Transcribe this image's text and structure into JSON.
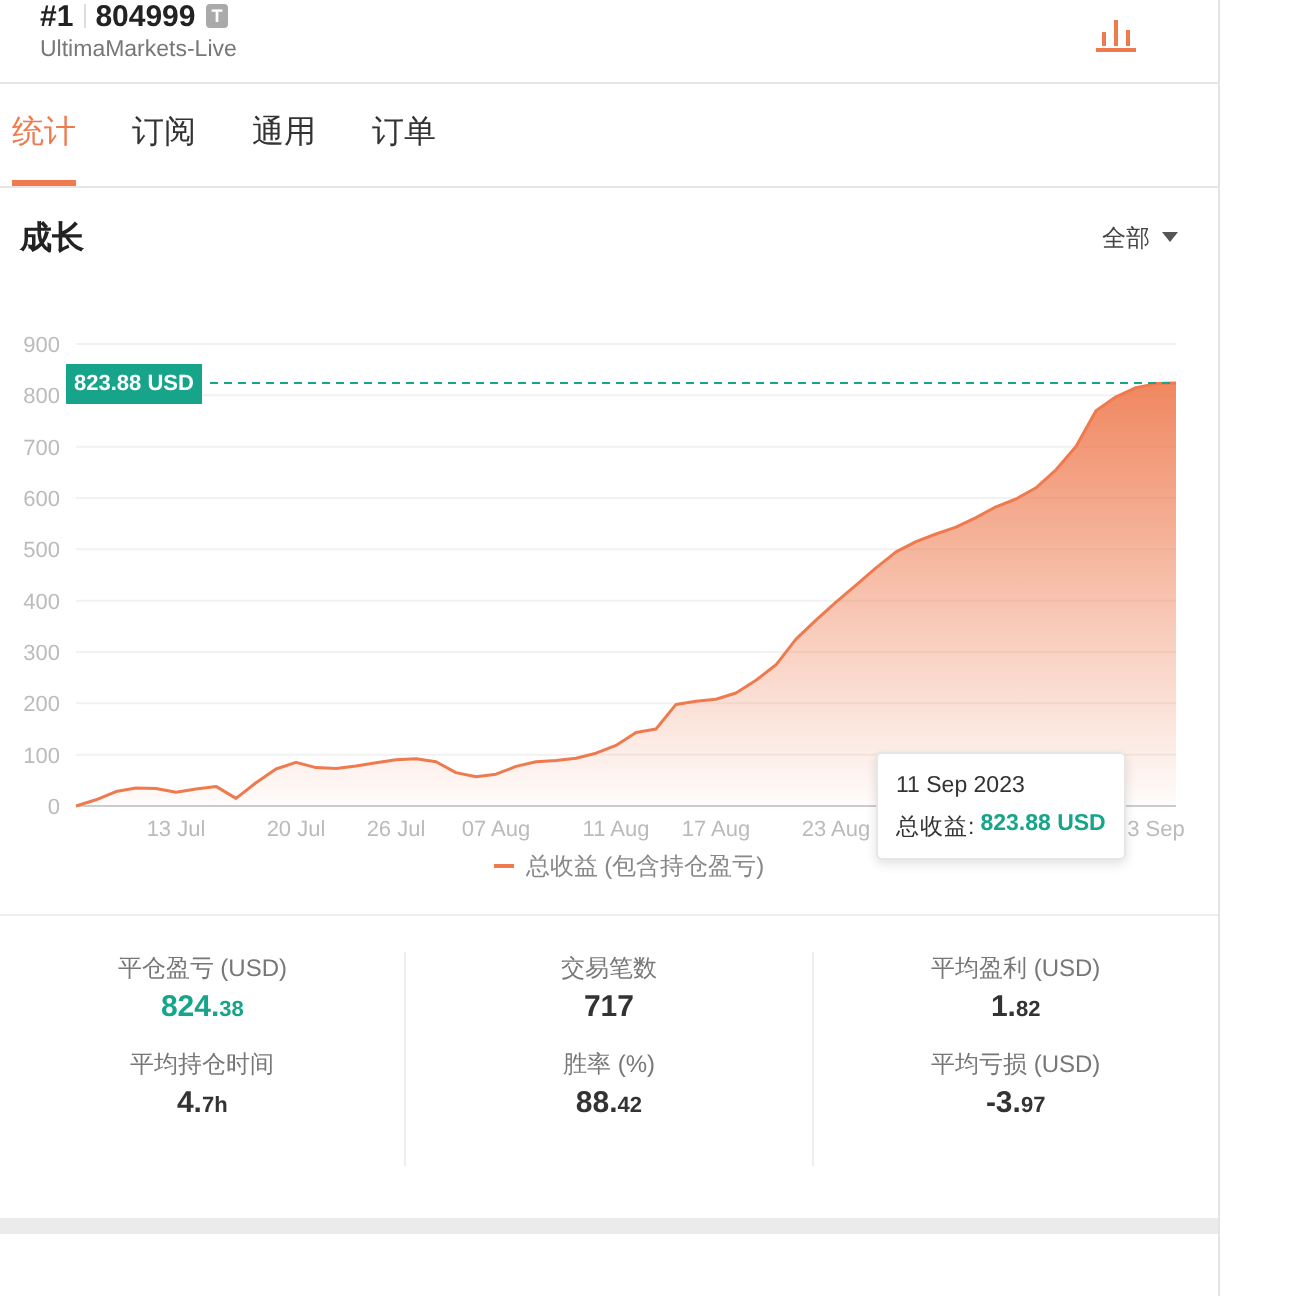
{
  "header": {
    "rank": "#1",
    "account": "804999",
    "badge": "T",
    "server": "UltimaMarkets-Live"
  },
  "tabs": [
    {
      "label": "统计",
      "selected": true
    },
    {
      "label": "订阅",
      "selected": false
    },
    {
      "label": "通用",
      "selected": false
    },
    {
      "label": "订单",
      "selected": false
    }
  ],
  "section": {
    "title": "成长",
    "filter": "全部"
  },
  "chart": {
    "price_label": "823.88 USD",
    "tooltip": {
      "date": "11 Sep 2023",
      "label": "总收益:",
      "value": "823.88 USD"
    },
    "chart_data": {
      "type": "area",
      "grid": true,
      "ref_lines": [
        {
          "axis": "y",
          "value": 823.88,
          "color": "#16a58a"
        }
      ],
      "ylim": [
        0,
        900
      ],
      "yticks": [
        0,
        100,
        200,
        300,
        400,
        500,
        600,
        700,
        800,
        900
      ],
      "categories": [
        null,
        null,
        null,
        null,
        null,
        "13 Jul",
        null,
        null,
        null,
        null,
        null,
        "20 Jul",
        null,
        null,
        null,
        null,
        "26 Jul",
        null,
        null,
        null,
        null,
        "07 Aug",
        null,
        null,
        null,
        null,
        null,
        "11 Aug",
        null,
        null,
        null,
        null,
        "17 Aug",
        null,
        null,
        null,
        null,
        null,
        "23 Aug",
        null,
        null,
        null,
        null,
        null,
        null,
        null,
        null,
        null,
        null,
        null,
        null,
        null,
        null,
        null,
        "3 Sep",
        null
      ],
      "series": [
        {
          "name": "总收益 (包含持仓盈亏)",
          "color": "#ee7a4e",
          "values": [
            0,
            12,
            28,
            35,
            34,
            27,
            33,
            38,
            15,
            45,
            72,
            85,
            75,
            73,
            78,
            84,
            90,
            92,
            86,
            65,
            57,
            62,
            77,
            86,
            89,
            93,
            103,
            118,
            143,
            150,
            198,
            204,
            208,
            220,
            245,
            275,
            325,
            362,
            397,
            430,
            464,
            495,
            515,
            530,
            543,
            562,
            583,
            598,
            620,
            655,
            700,
            770,
            797,
            815,
            823,
            824
          ]
        }
      ]
    }
  },
  "stats": [
    {
      "label": "平仓盈亏 (USD)",
      "value": "824.38",
      "highlight": true
    },
    {
      "label": "交易笔数",
      "value": "717",
      "highlight": false
    },
    {
      "label": "平均盈利 (USD)",
      "value": "1.82",
      "highlight": false
    },
    {
      "label": "平均持仓时间",
      "value": "4.7h",
      "highlight": false
    },
    {
      "label": "胜率 (%)",
      "value": "88.42",
      "highlight": false
    },
    {
      "label": "平均亏损 (USD)",
      "value": "-3.97",
      "highlight": false
    }
  ]
}
